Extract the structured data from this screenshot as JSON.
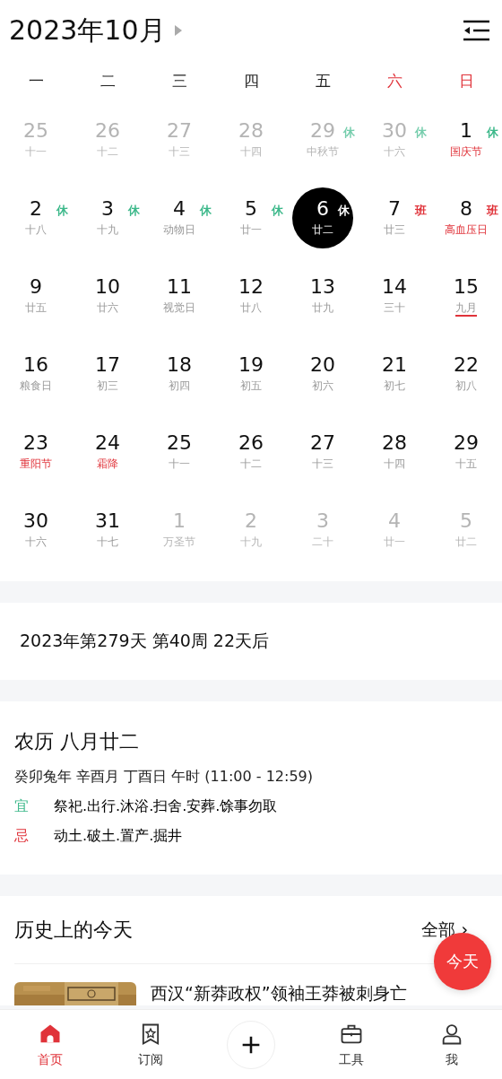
{
  "header": {
    "title": "2023年10月"
  },
  "weekdays": [
    {
      "label": "一",
      "weekend": false
    },
    {
      "label": "二",
      "weekend": false
    },
    {
      "label": "三",
      "weekend": false
    },
    {
      "label": "四",
      "weekend": false
    },
    {
      "label": "五",
      "weekend": false
    },
    {
      "label": "六",
      "weekend": true
    },
    {
      "label": "日",
      "weekend": true
    }
  ],
  "days": [
    {
      "day": "25",
      "sub": "十一",
      "muted": true,
      "festival": false,
      "selected": false
    },
    {
      "day": "26",
      "sub": "十二",
      "muted": true,
      "festival": false,
      "selected": false
    },
    {
      "day": "27",
      "sub": "十三",
      "muted": true,
      "festival": false,
      "selected": false
    },
    {
      "day": "28",
      "sub": "十四",
      "muted": true,
      "festival": false,
      "selected": false
    },
    {
      "day": "29",
      "sub": "中秋节",
      "muted": true,
      "festival": false,
      "selected": false,
      "badge": {
        "kind": "rest",
        "text": "休"
      }
    },
    {
      "day": "30",
      "sub": "十六",
      "muted": true,
      "festival": false,
      "selected": false,
      "badge": {
        "kind": "rest",
        "text": "休"
      }
    },
    {
      "day": "1",
      "sub": "国庆节",
      "muted": false,
      "festival": true,
      "selected": false,
      "badge": {
        "kind": "rest",
        "text": "休"
      }
    },
    {
      "day": "2",
      "sub": "十八",
      "muted": false,
      "festival": false,
      "selected": false,
      "badge": {
        "kind": "rest",
        "text": "休"
      }
    },
    {
      "day": "3",
      "sub": "十九",
      "muted": false,
      "festival": false,
      "selected": false,
      "badge": {
        "kind": "rest",
        "text": "休"
      }
    },
    {
      "day": "4",
      "sub": "动物日",
      "muted": false,
      "festival": false,
      "selected": false,
      "badge": {
        "kind": "rest",
        "text": "休"
      }
    },
    {
      "day": "5",
      "sub": "廿一",
      "muted": false,
      "festival": false,
      "selected": false,
      "badge": {
        "kind": "rest",
        "text": "休"
      }
    },
    {
      "day": "6",
      "sub": "廿二",
      "muted": false,
      "festival": false,
      "selected": true,
      "badge": {
        "kind": "rest",
        "text": "休"
      }
    },
    {
      "day": "7",
      "sub": "廿三",
      "muted": false,
      "festival": false,
      "selected": false,
      "badge": {
        "kind": "work",
        "text": "班"
      }
    },
    {
      "day": "8",
      "sub": "高血压日",
      "muted": false,
      "festival": true,
      "selected": false,
      "badge": {
        "kind": "work",
        "text": "班"
      }
    },
    {
      "day": "9",
      "sub": "廿五",
      "muted": false,
      "festival": false,
      "selected": false
    },
    {
      "day": "10",
      "sub": "廿六",
      "muted": false,
      "festival": false,
      "selected": false
    },
    {
      "day": "11",
      "sub": "视觉日",
      "muted": false,
      "festival": false,
      "selected": false
    },
    {
      "day": "12",
      "sub": "廿八",
      "muted": false,
      "festival": false,
      "selected": false
    },
    {
      "day": "13",
      "sub": "廿九",
      "muted": false,
      "festival": false,
      "selected": false
    },
    {
      "day": "14",
      "sub": "三十",
      "muted": false,
      "festival": false,
      "selected": false
    },
    {
      "day": "15",
      "sub": "九月",
      "muted": false,
      "festival": false,
      "selected": false,
      "underlined": true
    },
    {
      "day": "16",
      "sub": "粮食日",
      "muted": false,
      "festival": false,
      "selected": false
    },
    {
      "day": "17",
      "sub": "初三",
      "muted": false,
      "festival": false,
      "selected": false
    },
    {
      "day": "18",
      "sub": "初四",
      "muted": false,
      "festival": false,
      "selected": false
    },
    {
      "day": "19",
      "sub": "初五",
      "muted": false,
      "festival": false,
      "selected": false
    },
    {
      "day": "20",
      "sub": "初六",
      "muted": false,
      "festival": false,
      "selected": false
    },
    {
      "day": "21",
      "sub": "初七",
      "muted": false,
      "festival": false,
      "selected": false
    },
    {
      "day": "22",
      "sub": "初八",
      "muted": false,
      "festival": false,
      "selected": false
    },
    {
      "day": "23",
      "sub": "重阳节",
      "muted": false,
      "festival": true,
      "selected": false
    },
    {
      "day": "24",
      "sub": "霜降",
      "muted": false,
      "festival": true,
      "selected": false
    },
    {
      "day": "25",
      "sub": "十一",
      "muted": false,
      "festival": false,
      "selected": false
    },
    {
      "day": "26",
      "sub": "十二",
      "muted": false,
      "festival": false,
      "selected": false
    },
    {
      "day": "27",
      "sub": "十三",
      "muted": false,
      "festival": false,
      "selected": false
    },
    {
      "day": "28",
      "sub": "十四",
      "muted": false,
      "festival": false,
      "selected": false
    },
    {
      "day": "29",
      "sub": "十五",
      "muted": false,
      "festival": false,
      "selected": false
    },
    {
      "day": "30",
      "sub": "十六",
      "muted": false,
      "festival": false,
      "selected": false
    },
    {
      "day": "31",
      "sub": "十七",
      "muted": false,
      "festival": false,
      "selected": false
    },
    {
      "day": "1",
      "sub": "万圣节",
      "muted": true,
      "festival": false,
      "selected": false
    },
    {
      "day": "2",
      "sub": "十九",
      "muted": true,
      "festival": false,
      "selected": false
    },
    {
      "day": "3",
      "sub": "二十",
      "muted": true,
      "festival": false,
      "selected": false
    },
    {
      "day": "4",
      "sub": "廿一",
      "muted": true,
      "festival": false,
      "selected": false
    },
    {
      "day": "5",
      "sub": "廿二",
      "muted": true,
      "festival": false,
      "selected": false
    }
  ],
  "day_info": "2023年第279天 第40周 22天后",
  "lunar": {
    "title": "农历 八月廿二",
    "ganzhi": "癸卯兔年 辛酉月 丁酉日 午时 (11:00 - 12:59)",
    "rows": [
      {
        "kind": "good",
        "label": "宜",
        "text": "祭祀.出行.沐浴.扫舍.安葬.馀事勿取"
      },
      {
        "kind": "bad",
        "label": "忌",
        "text": "动土.破土.置产.掘井"
      }
    ]
  },
  "history": {
    "title": "历史上的今天",
    "more": "全部 ›",
    "items": [
      {
        "kind": "picture",
        "title": "西汉“新莽政权”领袖王莽被刺身亡"
      }
    ]
  },
  "today_button": "今天",
  "tabs": [
    {
      "label": "首页",
      "kind": "home",
      "selected": true
    },
    {
      "label": "订阅",
      "kind": "bookmark",
      "selected": false
    },
    {
      "label": "工具",
      "kind": "briefcase",
      "selected": false
    },
    {
      "label": "我",
      "kind": "user",
      "selected": false
    }
  ]
}
